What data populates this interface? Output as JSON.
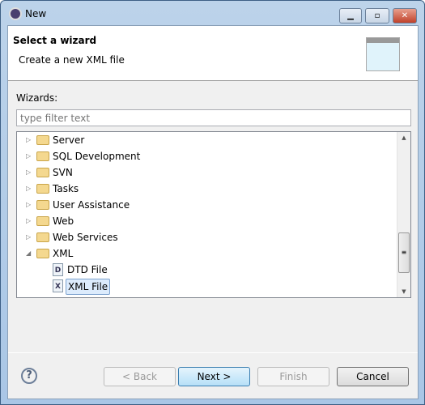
{
  "window": {
    "title": "New",
    "controls": [
      "minimize",
      "maximize",
      "close"
    ]
  },
  "header": {
    "title": "Select a wizard",
    "description": "Create a new XML file"
  },
  "wizards_label": "Wizards:",
  "filter": {
    "value": "",
    "placeholder": "type filter text"
  },
  "tree": [
    {
      "label": "Server",
      "type": "folder",
      "expanded": false
    },
    {
      "label": "SQL Development",
      "type": "folder",
      "expanded": false
    },
    {
      "label": "SVN",
      "type": "folder",
      "expanded": false
    },
    {
      "label": "Tasks",
      "type": "folder",
      "expanded": false
    },
    {
      "label": "User Assistance",
      "type": "folder",
      "expanded": false
    },
    {
      "label": "Web",
      "type": "folder",
      "expanded": false
    },
    {
      "label": "Web Services",
      "type": "folder",
      "expanded": false
    },
    {
      "label": "XML",
      "type": "folder",
      "expanded": true
    },
    {
      "label": "DTD File",
      "type": "file",
      "glyph": "D"
    },
    {
      "label": "XML File",
      "type": "file",
      "glyph": "X",
      "selected": true
    }
  ],
  "buttons": {
    "back": "< Back",
    "next": "Next >",
    "finish": "Finish",
    "cancel": "Cancel",
    "help": "?"
  }
}
